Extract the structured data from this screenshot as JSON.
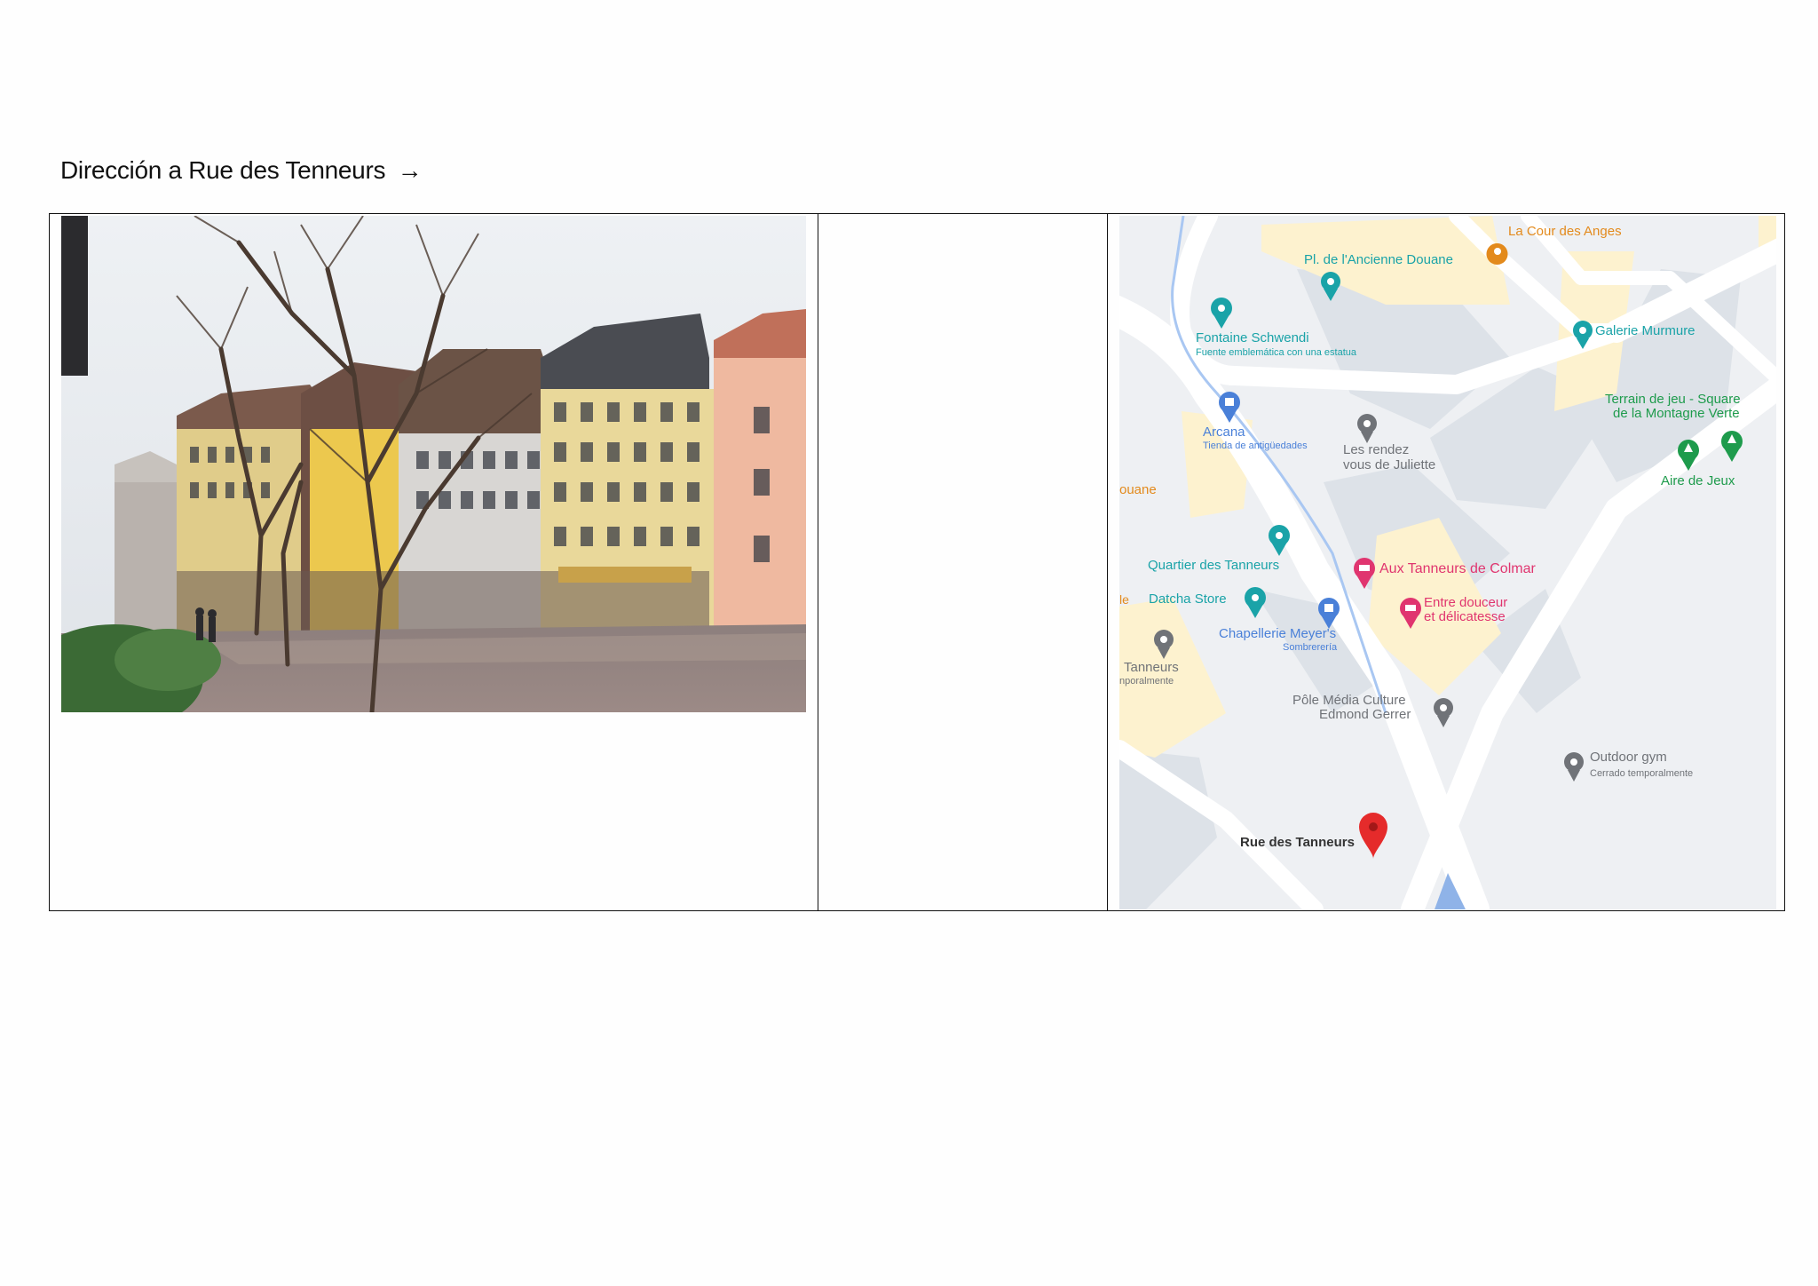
{
  "document": {
    "heading": "Dirección a Rue des Tenneurs",
    "heading_arrow": "→"
  },
  "map": {
    "labels": {
      "cour_des_anges": "La Cour des Anges",
      "pl_ancienne_douane": "Pl. de l'Ancienne Douane",
      "fontaine_schwendi": "Fontaine Schwendi",
      "fontaine_desc": "Fuente emblemática con una estatua",
      "galerie_murmure": "Galerie Murmure",
      "terrain_1": "Terrain de jeu - Square",
      "terrain_2": "de la Montagne Verte",
      "aire_de_jeux": "Aire de Jeux",
      "arcana": "Arcana",
      "arcana_desc": "Tienda de antigüedades",
      "rendez_1": "Les rendez",
      "rendez_2": "vous de Juliette",
      "douane_cut": "ouane",
      "quartier": "Quartier des Tanneurs",
      "aux_tanneurs": "Aux Tanneurs de Colmar",
      "le_cut": "le",
      "datcha": "Datcha Store",
      "entre_1": "Entre douceur",
      "entre_2": "et délicatesse",
      "chapellerie": "Chapellerie Meyer's",
      "chapellerie_desc": "Sombrerería",
      "tanneurs_cut": "Tanneurs",
      "tanneurs_cut_desc": "nporalmente",
      "pole_1": "Pôle Média Culture",
      "pole_2": "Edmond Gerrer",
      "outdoor_gym": "Outdoor gym",
      "outdoor_desc": "Cerrado temporalmente",
      "rue_des_tanneurs": "Rue des Tanneurs"
    },
    "colors": {
      "teal": "#1aa3a8",
      "blue": "#4a80d8",
      "pink": "#e0356f",
      "orange": "#e38a1c",
      "green": "#1e9b4c",
      "gray": "#707378",
      "red": "#e52b2b",
      "road": "#ffffff",
      "building": "#dde2e8",
      "block": "#fdf2cf",
      "base": "#eef0f3"
    }
  }
}
